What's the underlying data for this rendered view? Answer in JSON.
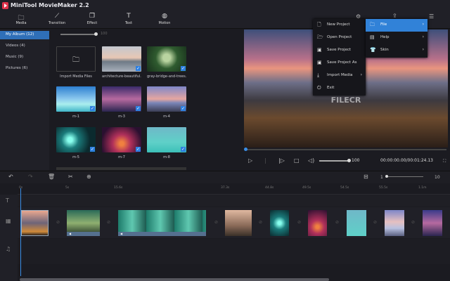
{
  "app": {
    "title": "MiniTool MovieMaker 2.2"
  },
  "toolbar": [
    {
      "label": "Media",
      "icon": "folder-icon"
    },
    {
      "label": "Transition",
      "icon": "transition-icon"
    },
    {
      "label": "Effect",
      "icon": "effect-icon"
    },
    {
      "label": "Text",
      "icon": "text-icon"
    },
    {
      "label": "Motion",
      "icon": "motion-icon"
    }
  ],
  "sidebar": {
    "items": [
      {
        "label": "My Album  (12)",
        "selected": true
      },
      {
        "label": "Videos  (4)"
      },
      {
        "label": "Music  (9)"
      },
      {
        "label": "Pictures  (6)"
      }
    ]
  },
  "library": {
    "zoom_value": "100",
    "items": [
      {
        "label": "Import Media Files",
        "checked": false
      },
      {
        "label": "architecture-beautiful...",
        "checked": true
      },
      {
        "label": "gray-bridge-and-trees...",
        "checked": true
      },
      {
        "label": "m-1",
        "checked": true
      },
      {
        "label": "m-3",
        "checked": true
      },
      {
        "label": "m-4",
        "checked": true
      },
      {
        "label": "m-5",
        "checked": true
      },
      {
        "label": "m-7",
        "checked": true
      },
      {
        "label": "m-8",
        "checked": true
      }
    ]
  },
  "preview": {
    "watermark": "FILECR",
    "volume": "100",
    "timecode": "00:00:00.00/00:01:24.13",
    "progress": 0
  },
  "menu": {
    "items": [
      {
        "label": "New Project",
        "icon": "new-project-icon"
      },
      {
        "label": "Open Project",
        "icon": "open-folder-icon"
      },
      {
        "label": "Save Project",
        "icon": "save-icon"
      },
      {
        "label": "Save Project As",
        "icon": "save-as-icon"
      },
      {
        "label": "Import Media",
        "icon": "import-icon",
        "submenu": true
      },
      {
        "label": "Exit",
        "icon": "power-icon"
      }
    ]
  },
  "submenu": {
    "items": [
      {
        "label": "File",
        "icon": "folder-icon",
        "selected": true
      },
      {
        "label": "Help",
        "icon": "help-icon"
      },
      {
        "label": "Skin",
        "icon": "shirt-icon"
      }
    ]
  },
  "timeline": {
    "zoom_min": "1",
    "zoom_max": "10",
    "ruler": [
      "0s",
      "5s",
      "15.6s",
      "37.3s",
      "44.8s",
      "49.5s",
      "54.5s",
      "55.5s",
      "1.1m"
    ]
  }
}
